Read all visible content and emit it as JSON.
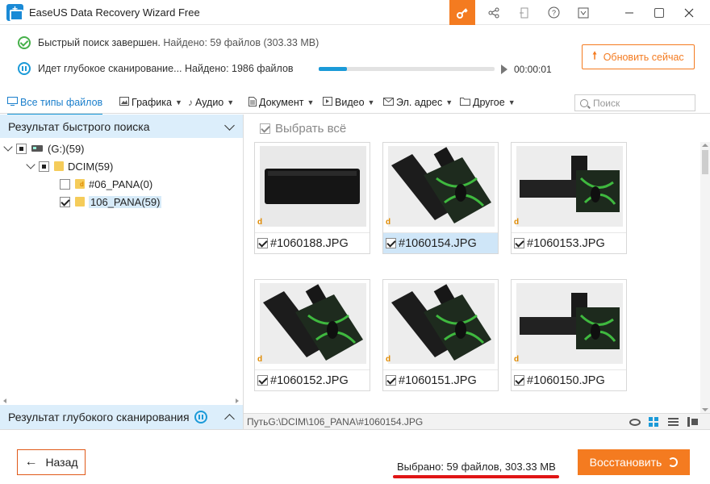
{
  "window": {
    "title": "EaseUS Data Recovery Wizard Free"
  },
  "status": {
    "quick_scan": "Быстрый поиск завершен.",
    "quick_found": "Найдено: 59 файлов (303.33 MB)",
    "deep_scan": "Идет глубокое сканирование...",
    "deep_found": "Найдено: 1986 файлов",
    "progress": 0.16,
    "timer": "00:00:01",
    "update_label": "Обновить сейчас"
  },
  "filters": [
    {
      "label": "Все типы файлов",
      "icon": "monitor-icon",
      "active": true
    },
    {
      "label": "Графика",
      "icon": "image-icon"
    },
    {
      "label": "Аудио",
      "icon": "music-icon"
    },
    {
      "label": "Документ",
      "icon": "document-icon"
    },
    {
      "label": "Видео",
      "icon": "video-icon"
    },
    {
      "label": "Эл. адрес",
      "icon": "mail-icon"
    },
    {
      "label": "Другое",
      "icon": "folder-icon"
    }
  ],
  "search": {
    "placeholder": "Поиск"
  },
  "left": {
    "quick_header": "Результат быстрого поиска",
    "tree": [
      {
        "label": "(G:)(59)"
      },
      {
        "label": "DCIM(59)"
      },
      {
        "label": "#06_PANA(0)"
      },
      {
        "label": "106_PANA(59)"
      }
    ],
    "deep_header": "Результат глубокого сканирования"
  },
  "right": {
    "select_all": "Выбрать всё",
    "files": [
      {
        "name": "#1060188.JPG",
        "thumb": "dark-object"
      },
      {
        "name": "#1060154.JPG",
        "thumb": "keyboard-mat",
        "selected": true
      },
      {
        "name": "#1060153.JPG",
        "thumb": "keyboard-mat-2"
      },
      {
        "name": "#1060152.JPG",
        "thumb": "keyboard-mat"
      },
      {
        "name": "#1060151.JPG",
        "thumb": "keyboard-mat"
      },
      {
        "name": "#1060150.JPG",
        "thumb": "keyboard-mat-2"
      }
    ],
    "path": "ПутьG:\\DCIM\\106_PANA\\#1060154.JPG"
  },
  "bottom": {
    "back_label": "Назад",
    "selected_info": "Выбрано: 59 файлов, 303.33 MB",
    "restore_label": "Восстановить"
  },
  "colors": {
    "accent": "#f47b20",
    "blue": "#1b9ad8",
    "underline": "#e01515"
  }
}
